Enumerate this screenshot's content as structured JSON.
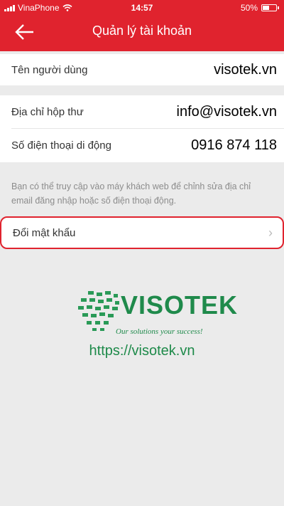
{
  "status_bar": {
    "carrier": "VinaPhone",
    "time": "14:57",
    "battery": "50%"
  },
  "header": {
    "title": "Quản lý tài khoản",
    "back_icon": "arrow-left-icon"
  },
  "account": {
    "username_label": "Tên người dùng",
    "username_value": "visotek.vn",
    "email_label": "Địa chỉ hộp thư",
    "email_value": "info@visotek.vn",
    "phone_label": "Số điện thoại di động",
    "phone_value": "0916 874 118"
  },
  "note": "Bạn có thể truy cập vào máy khách web để chỉnh sửa địa chỉ email đăng nhập hoặc số điện thoại động.",
  "change_password": {
    "label": "Đổi mật khẩu",
    "icon": "chevron-right-icon"
  },
  "branding": {
    "name": "VISOTEK",
    "slogan": "Our solutions your success!",
    "url": "https://visotek.vn"
  },
  "colors": {
    "header": "#e0232e",
    "brand_green": "#1f8a4b"
  }
}
